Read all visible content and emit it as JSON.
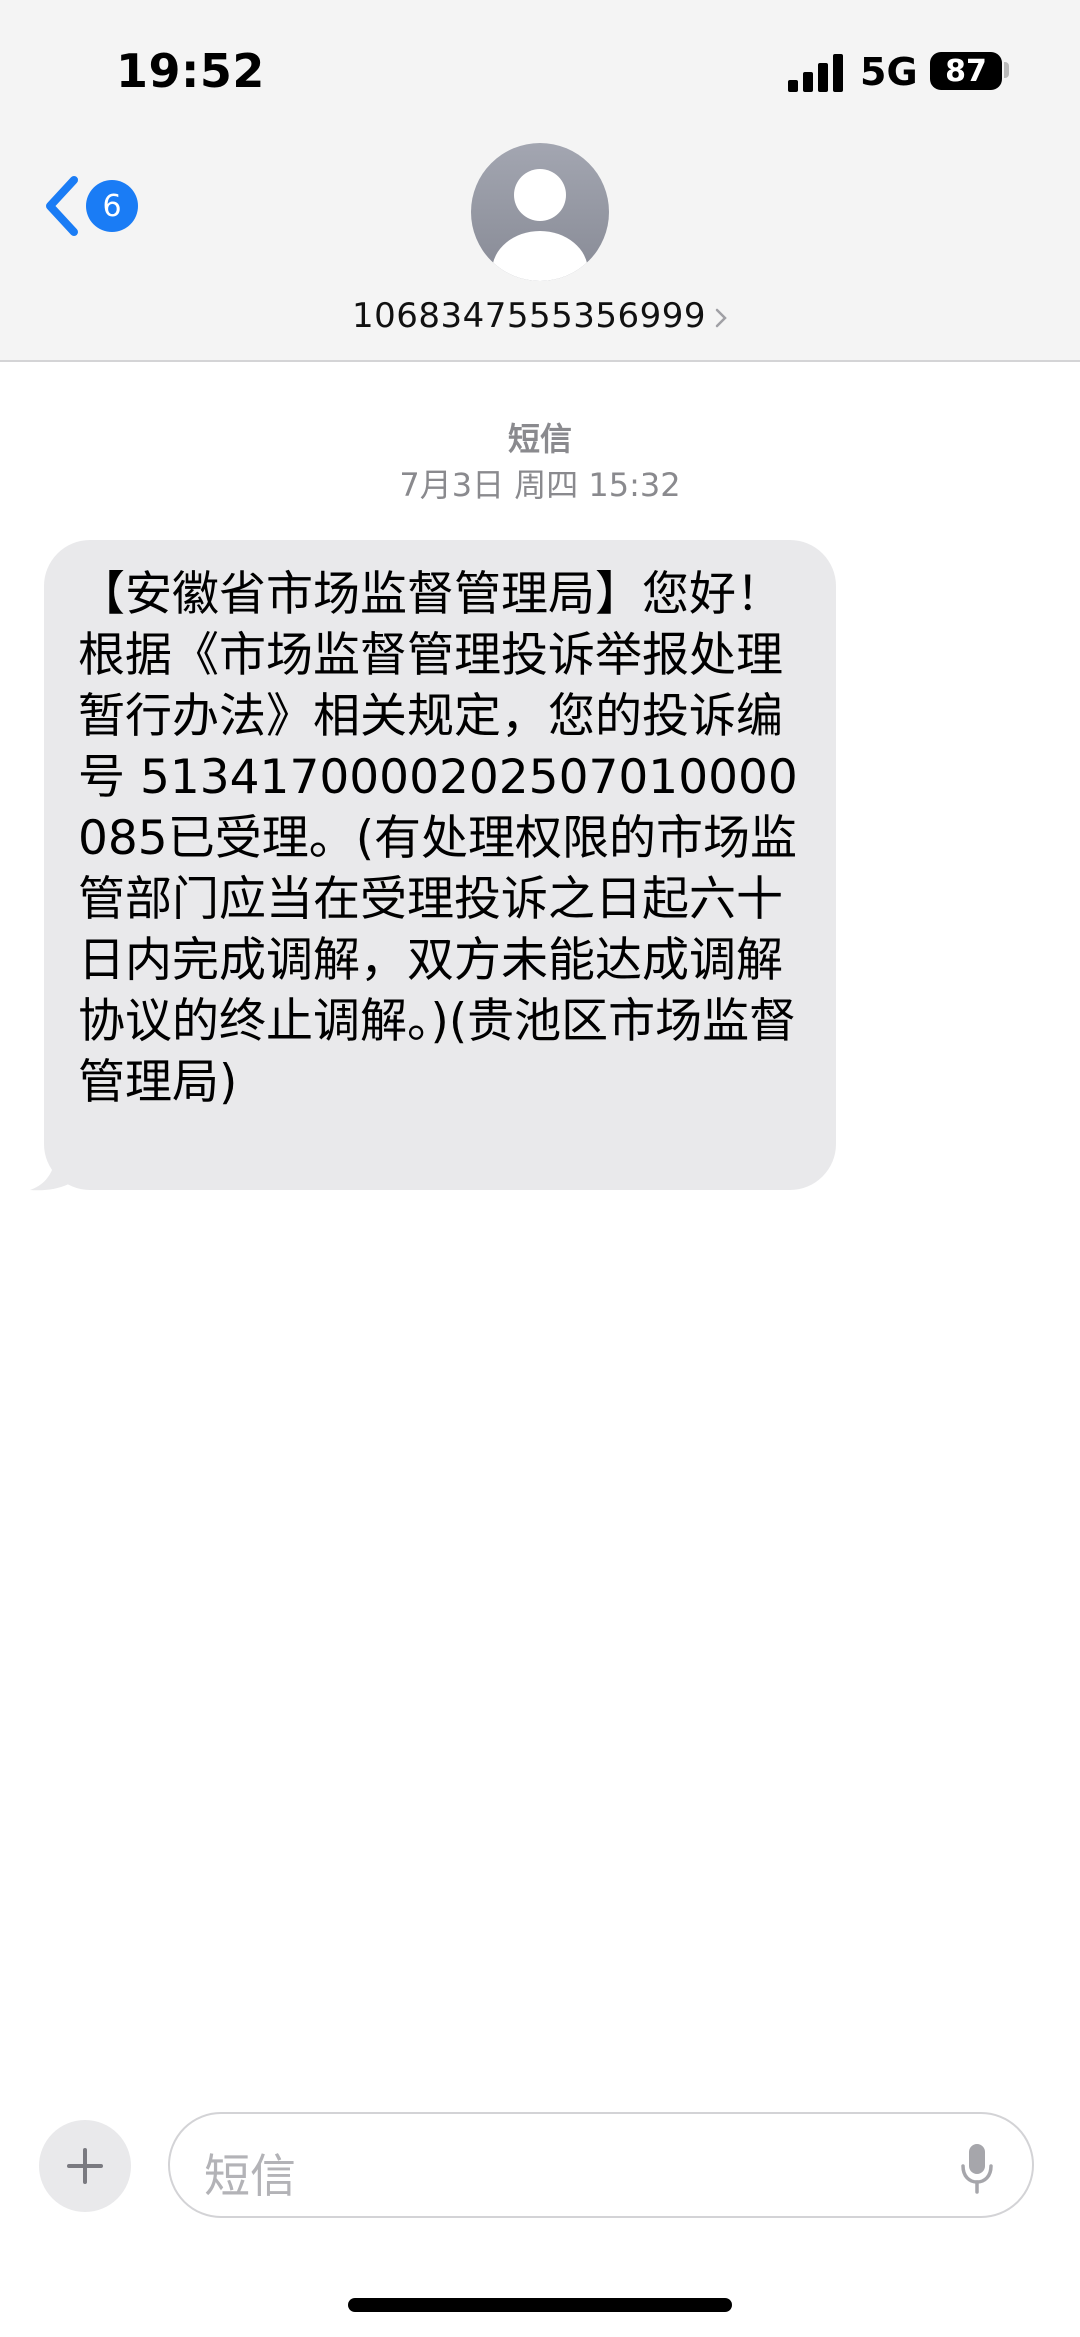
{
  "status_bar": {
    "time": "19:52",
    "network": "5G",
    "battery_level": "87"
  },
  "nav": {
    "unread_count": "6",
    "contact_number": "1068347555356999"
  },
  "conversation": {
    "label": "短信",
    "date": "7月3日 周四 15:32",
    "messages": [
      {
        "direction": "incoming",
        "text": "【安徽省市场监督管理局】您好！根据《市场监督管理投诉举报处理暂行办法》相关规定，您的投诉编号 5134170000202507010000085已受理。(有处理权限的市场监管部门应当在受理投诉之日起六十日内完成调解，双方未能达成调解协议的终止调解。)(贵池区市场监督管理局)"
      }
    ]
  },
  "composer": {
    "placeholder": "短信"
  },
  "colors": {
    "accent": "#1a7cf5",
    "header_bg": "#f4f4f4",
    "bubble_bg": "#e9e9eb",
    "secondary_text": "#8a8a8e"
  }
}
